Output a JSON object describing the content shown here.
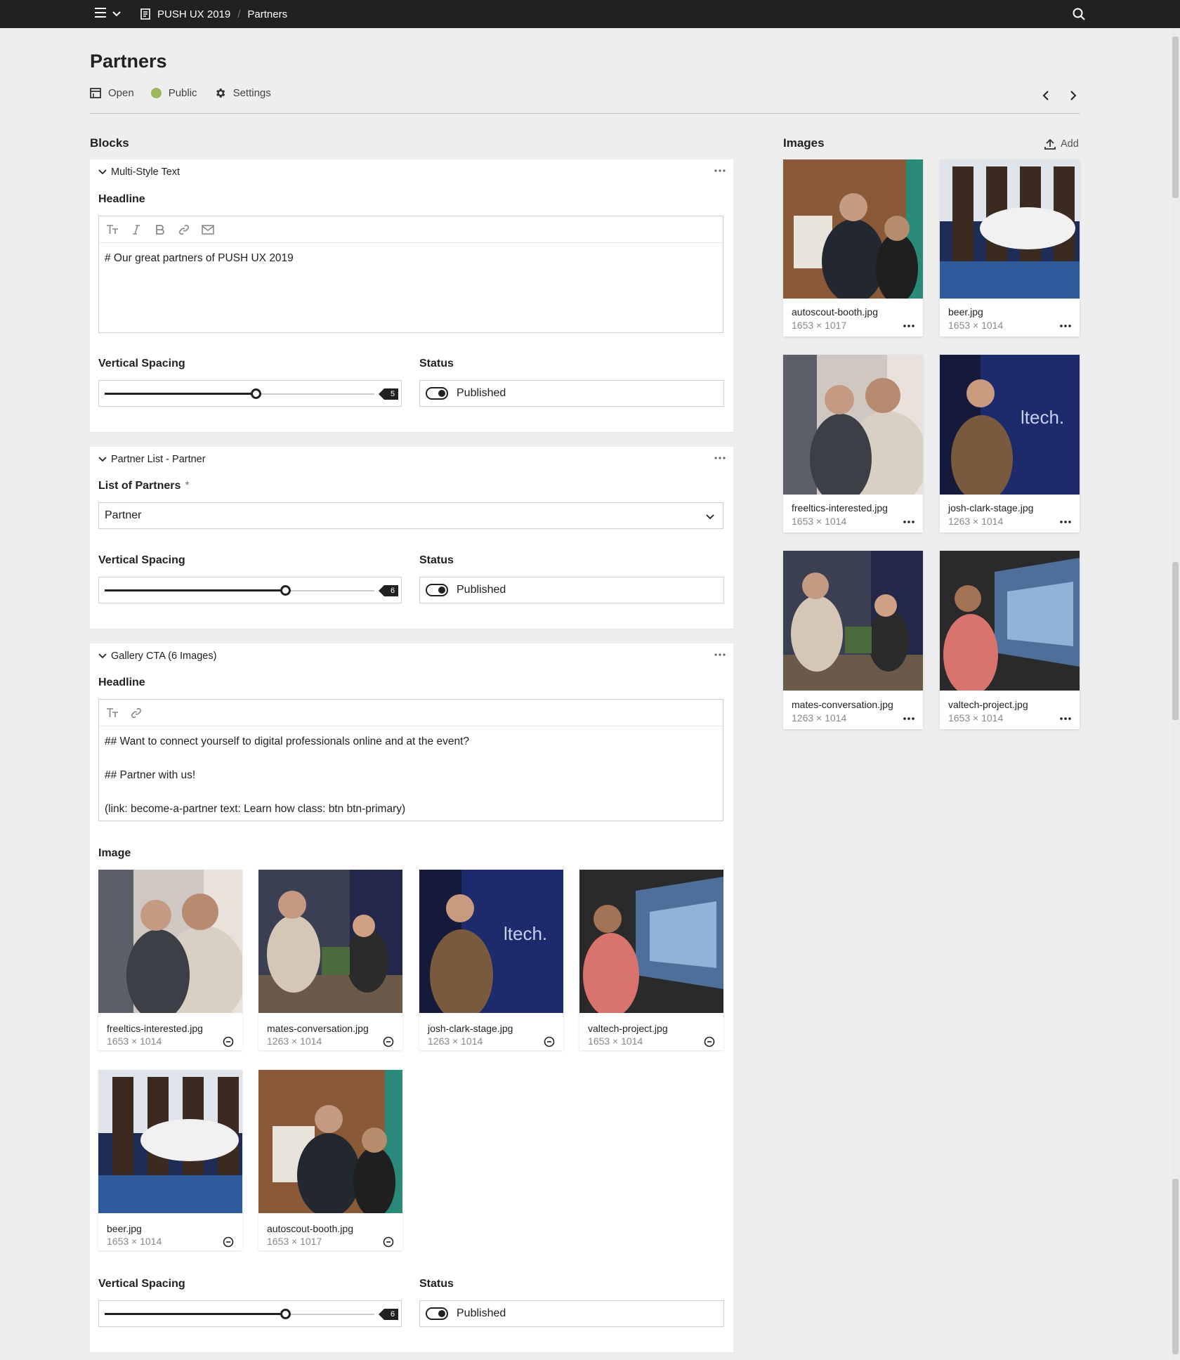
{
  "topbar": {
    "project": "PUSH UX 2019",
    "page": "Partners",
    "separator": "/"
  },
  "page": {
    "title": "Partners",
    "subnav": {
      "open_label": "Open",
      "visibility_label": "Public",
      "settings_label": "Settings"
    },
    "colors": {
      "accent_public": "#9cb85f",
      "topbar_bg": "#212121",
      "page_bg": "#eeeeee"
    }
  },
  "blocks_section": {
    "title": "Blocks",
    "blocks": [
      {
        "type_label": "Multi-Style Text",
        "headline_label": "Headline",
        "headline_text": "# Our great partners of PUSH UX 2019",
        "spacing_label": "Vertical Spacing",
        "spacing_value": "5",
        "spacing_fraction": 0.56,
        "status_label": "Status",
        "status_value": "Published"
      },
      {
        "type_label": "Partner List - Partner",
        "list_label": "List of Partners",
        "required_mark": "*",
        "list_value": "Partner",
        "spacing_label": "Vertical Spacing",
        "spacing_value": "6",
        "spacing_fraction": 0.67,
        "status_label": "Status",
        "status_value": "Published"
      },
      {
        "type_label": "Gallery CTA (6 Images)",
        "headline_label": "Headline",
        "headline_text": "## Want to connect yourself to digital professionals online and at the event?\n\n## Partner with us!\n\n(link: become-a-partner text: Learn how class: btn btn-primary)",
        "image_label": "Image",
        "images": [
          {
            "name": "freeltics-interested.jpg",
            "dims": "1653 × 1014"
          },
          {
            "name": "mates-conversation.jpg",
            "dims": "1263 × 1014"
          },
          {
            "name": "josh-clark-stage.jpg",
            "dims": "1263 × 1014"
          },
          {
            "name": "valtech-project.jpg",
            "dims": "1653 × 1014"
          },
          {
            "name": "beer.jpg",
            "dims": "1653 × 1014"
          },
          {
            "name": "autoscout-booth.jpg",
            "dims": "1653 × 1017"
          }
        ],
        "spacing_label": "Vertical Spacing",
        "spacing_value": "6",
        "spacing_fraction": 0.67,
        "status_label": "Status",
        "status_value": "Published"
      }
    ]
  },
  "images_section": {
    "title": "Images",
    "add_label": "Add",
    "images": [
      {
        "name": "autoscout-booth.jpg",
        "dims": "1653 × 1017"
      },
      {
        "name": "beer.jpg",
        "dims": "1653 × 1014"
      },
      {
        "name": "freeltics-interested.jpg",
        "dims": "1653 × 1014"
      },
      {
        "name": "josh-clark-stage.jpg",
        "dims": "1263 × 1014"
      },
      {
        "name": "mates-conversation.jpg",
        "dims": "1263 × 1014"
      },
      {
        "name": "valtech-project.jpg",
        "dims": "1653 × 1014"
      }
    ]
  }
}
